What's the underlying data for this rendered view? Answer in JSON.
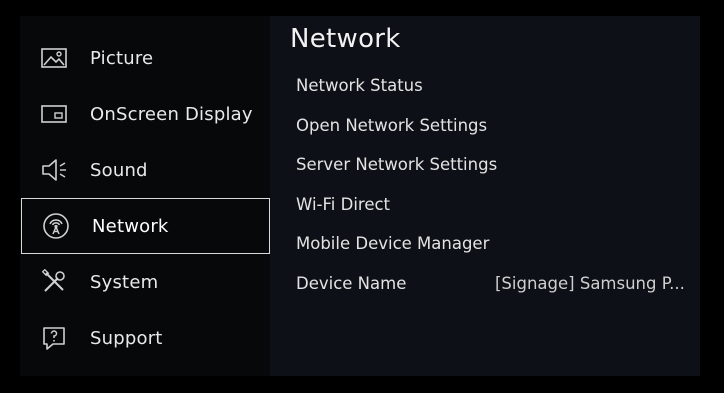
{
  "sidebar": {
    "items": [
      {
        "label": "Picture",
        "icon": "picture-icon"
      },
      {
        "label": "OnScreen Display",
        "icon": "onscreen-display-icon"
      },
      {
        "label": "Sound",
        "icon": "speaker-icon"
      },
      {
        "label": "Network",
        "icon": "network-icon",
        "selected": true
      },
      {
        "label": "System",
        "icon": "tools-icon"
      },
      {
        "label": "Support",
        "icon": "support-icon"
      }
    ]
  },
  "main": {
    "title": "Network",
    "options": [
      {
        "label": "Network Status"
      },
      {
        "label": "Open Network Settings"
      },
      {
        "label": "Server Network Settings"
      },
      {
        "label": "Wi-Fi Direct"
      },
      {
        "label": "Mobile Device Manager"
      },
      {
        "label": "Device Name",
        "value": "[Signage] Samsung P..."
      }
    ]
  },
  "colors": {
    "background": "#000000",
    "sidebar": "#07080a",
    "content": "#0d1117",
    "selection_border": "#d9d9d9"
  }
}
